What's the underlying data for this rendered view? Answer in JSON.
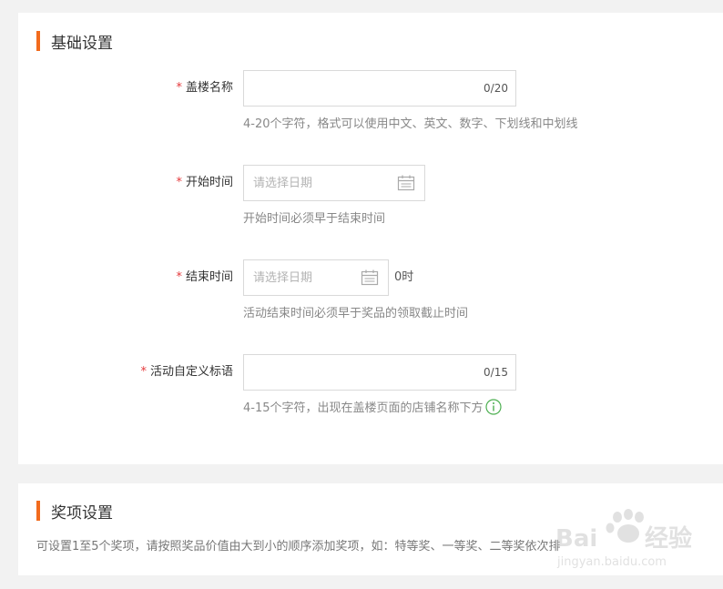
{
  "basic": {
    "title": "基础设置",
    "floor_name": {
      "label": "盖楼名称",
      "counter": "0/20",
      "hint": "4-20个字符，格式可以使用中文、英文、数字、下划线和中划线"
    },
    "start_time": {
      "label": "开始时间",
      "placeholder": "请选择日期",
      "hint": "开始时间必须早于结束时间"
    },
    "end_time": {
      "label": "结束时间",
      "placeholder": "请选择日期",
      "suffix": "0时",
      "hint": "活动结束时间必须早于奖品的领取截止时间"
    },
    "custom_slogan": {
      "label": "活动自定义标语",
      "counter": "0/15",
      "hint": "4-15个字符，出现在盖楼页面的店铺名称下方"
    }
  },
  "prize": {
    "title": "奖项设置",
    "description": "可设置1至5个奖项，请按照奖品价值由大到小的顺序添加奖项，如：特等奖、一等奖、二等奖依次排"
  },
  "watermark": {
    "brand": "Baidu经验",
    "url": "jingyan.baidu.com"
  },
  "colors": {
    "accent": "#f26b1d",
    "required": "#e4393c",
    "info": "#4caf50"
  },
  "icons": {
    "date_picker": "calendar-icon",
    "info": "info-circle-icon"
  }
}
